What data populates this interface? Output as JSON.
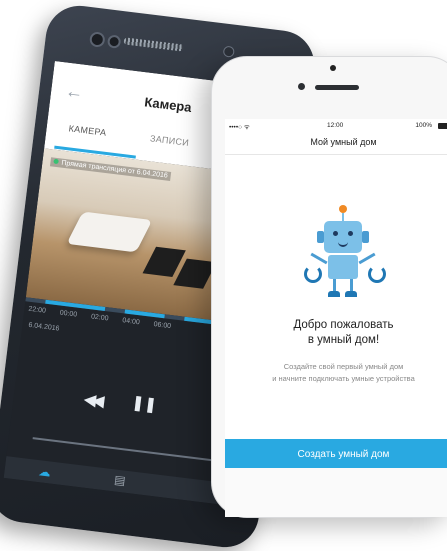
{
  "back_phone": {
    "title": "Камера",
    "tabs": [
      "КАМЕРА",
      "ЗАПИСИ"
    ],
    "live_label": "Прямая трансляция от 6.04.2016",
    "timeline_ticks": [
      "22:00",
      "00:00",
      "02:00",
      "04:00",
      "06:00"
    ],
    "date": "6.04.2016",
    "accent_color": "#29a9e1"
  },
  "front_phone": {
    "status": {
      "carrier": "••••○ ᯤ",
      "time": "12:00",
      "battery": "100%"
    },
    "nav_title": "Мой умный дом",
    "welcome_line1": "Добро пожаловать",
    "welcome_line2": "в умный дом!",
    "subtext_line1": "Создайте свой первый умный дом",
    "subtext_line2": "и начните подключать умные устройства",
    "create_button": "Создать умный дом",
    "accent_color": "#29a9e1",
    "illustration": "robot-icon"
  }
}
